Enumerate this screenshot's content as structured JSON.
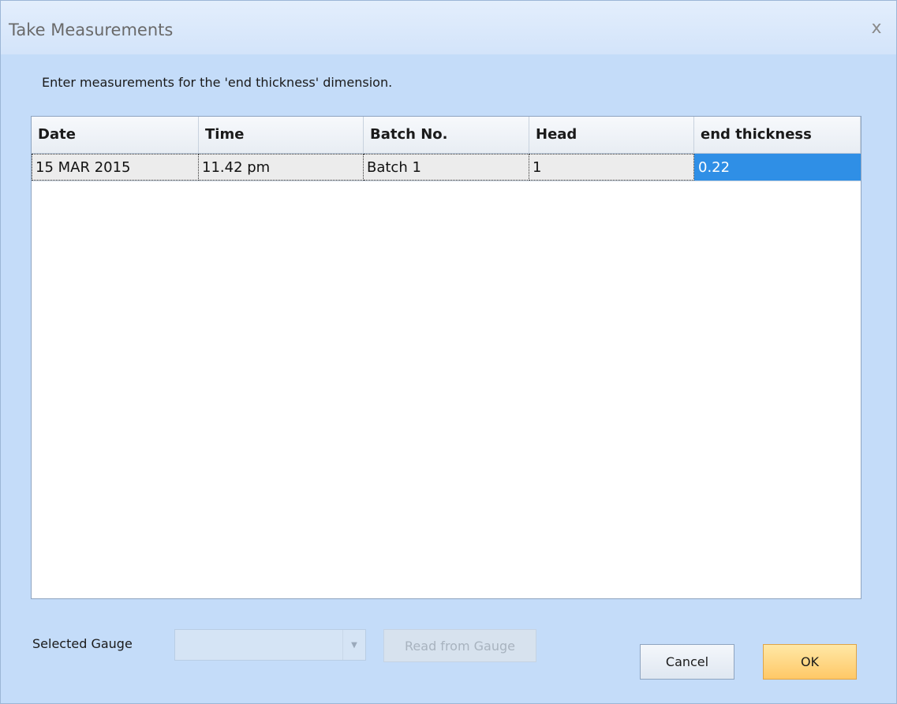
{
  "window": {
    "title": "Take Measurements",
    "close_label": "x"
  },
  "instructions": "Enter measurements for the 'end thickness' dimension.",
  "grid": {
    "columns": [
      "Date",
      "Time",
      "Batch No.",
      "Head",
      "end thickness"
    ],
    "rows": [
      [
        "15 MAR 2015",
        "11.42 pm",
        "Batch 1",
        "1",
        "0.22"
      ]
    ]
  },
  "gauge": {
    "label": "Selected Gauge",
    "selected_value": "",
    "read_button_label": "Read from Gauge"
  },
  "buttons": {
    "cancel_label": "Cancel",
    "ok_label": "OK"
  },
  "colors": {
    "dialog_background": "#c4dcf9",
    "selection": "#2f8fe6",
    "ok_button": "#ffc867"
  }
}
